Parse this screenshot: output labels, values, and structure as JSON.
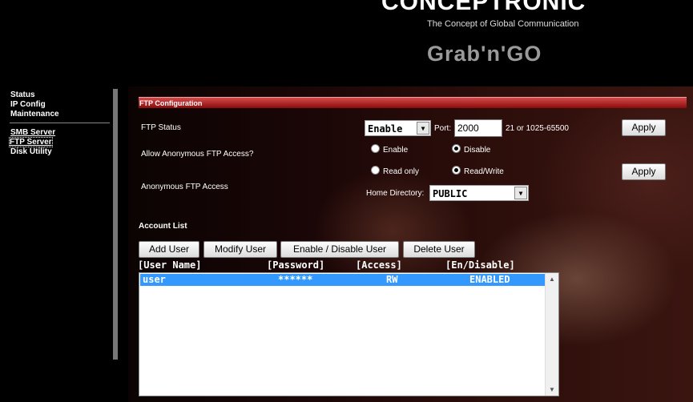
{
  "header": {
    "brand": "CONCEPTRONIC",
    "tagline": "The Concept of Global Communication",
    "product": "Grab'n'GO"
  },
  "nav": {
    "group1": [
      "Status",
      "IP Config",
      "Maintenance"
    ],
    "group2": [
      "SMB Server",
      "FTP Server",
      "Disk Utility"
    ]
  },
  "ftp_config": {
    "section_title": "FTP Configuration",
    "status_label": "FTP Status",
    "status_value": "Enable",
    "port_label": "Port:",
    "port_value": "2000",
    "port_hint": "21 or 1025-65500",
    "apply1": "Apply",
    "anon_label": "Allow Anonymous FTP Access?",
    "anon_enable": "Enable",
    "anon_disable": "Disable",
    "anon_access_label": "Anonymous FTP Access",
    "read_only": "Read only",
    "read_write": "Read/Write",
    "apply2": "Apply",
    "home_dir_label": "Home Directory:",
    "home_dir_value": "PUBLIC"
  },
  "accounts": {
    "title": "Account List",
    "buttons": [
      "Add User",
      "Modify User",
      "Enable / Disable User",
      "Delete User"
    ],
    "columns": [
      "[User Name]",
      "[Password]",
      "[Access]",
      "[En/Disable]"
    ],
    "rows": [
      {
        "user": "user",
        "password": "******",
        "access": "RW",
        "status": "ENABLED"
      }
    ]
  }
}
